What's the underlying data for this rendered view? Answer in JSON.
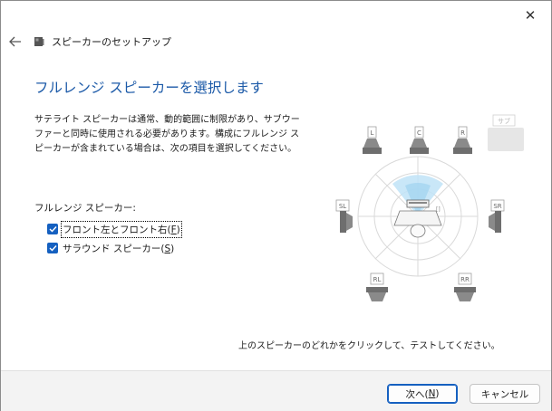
{
  "window": {
    "close_glyph": "✕"
  },
  "header": {
    "title": "スピーカーのセットアップ",
    "back_icon": "arrow-left-icon",
    "app_icon": "speaker-icon"
  },
  "content": {
    "main_instruction": "フルレンジ スピーカーを選択します",
    "description": "サテライト スピーカーは通常、動的範囲に制限があり、サブウーファーと同時に使用される必要があります。構成にフルレンジ スピーカーが含まれている場合は、次の項目を選択してください。",
    "section_label": "フルレンジ スピーカー:",
    "options": [
      {
        "label": "フロント左とフロント右(",
        "accel": "F",
        "suffix": ")",
        "checked": true
      },
      {
        "label": "サラウンド スピーカー(",
        "accel": "S",
        "suffix": ")",
        "checked": true
      }
    ],
    "hint": "上のスピーカーのどれかをクリックして、テストしてください。"
  },
  "diagram": {
    "speakers": {
      "L": "L",
      "C": "C",
      "R": "R",
      "SUB": "サブ",
      "SL": "SL",
      "SR": "SR",
      "RL": "RL",
      "RR": "RR"
    },
    "colors": {
      "speaker": "#8a8a8a",
      "label_border": "#a0a0a0",
      "highlight": "#bfe3f7",
      "sub_disabled": "#e6e6e6"
    }
  },
  "footer": {
    "next": "次へ(",
    "next_accel": "N",
    "next_suffix": ")",
    "cancel": "キャンセル"
  },
  "colors": {
    "accent": "#1560c0",
    "instruction": "#1c5aa8"
  }
}
